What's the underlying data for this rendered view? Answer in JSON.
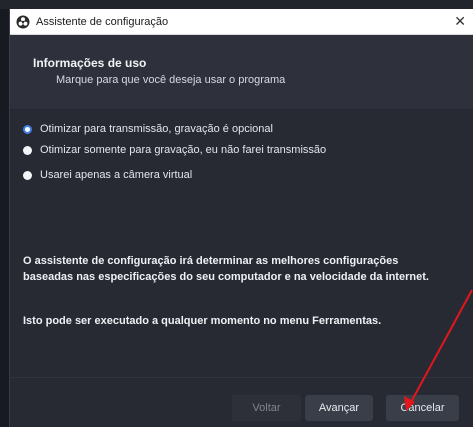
{
  "window": {
    "title": "Assistente de configuração",
    "close_glyph": "✕"
  },
  "header": {
    "title": "Informações de uso",
    "subtitle": "Marque para que você deseja usar o programa"
  },
  "options": [
    {
      "label": "Otimizar para transmissão, gravação é opcional",
      "checked": true
    },
    {
      "label": "Otimizar somente para gravação, eu não farei transmissão",
      "checked": false
    },
    {
      "label": "Usarei apenas a câmera virtual",
      "checked": false
    }
  ],
  "info": {
    "paragraph1": "O assistente de configuração irá determinar as melhores configurações baseadas nas especificações do seu computador e na velocidade da internet.",
    "paragraph2": "Isto pode ser executado a qualquer momento no menu Ferramentas."
  },
  "buttons": {
    "back": "Voltar",
    "next": "Avançar",
    "cancel": "Cancelar"
  },
  "colors": {
    "accent": "#3f7fe6",
    "annotation_arrow": "#e3161b",
    "dialog_bg": "#272a33",
    "header_bg": "#2e313b"
  },
  "icons": {
    "app": "obs-logo-icon",
    "close": "close-icon",
    "annotation": "red-arrow-annotation"
  }
}
